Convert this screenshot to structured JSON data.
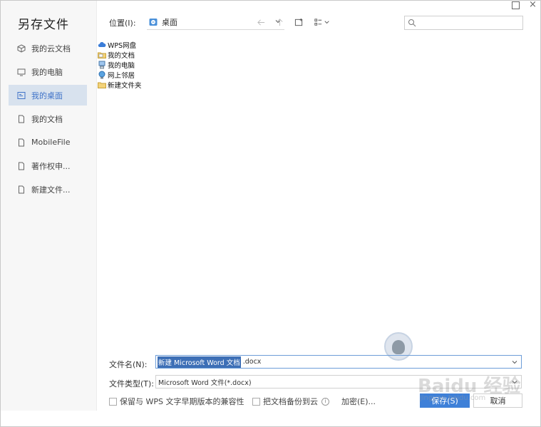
{
  "dialog": {
    "title": "另存文件"
  },
  "sidebar": {
    "items": [
      {
        "label": "我的云文档",
        "icon": "cloud-cube-icon",
        "active": false
      },
      {
        "label": "我的电脑",
        "icon": "monitor-icon",
        "active": false
      },
      {
        "label": "我的桌面",
        "icon": "desktop-icon",
        "active": true
      },
      {
        "label": "我的文档",
        "icon": "document-icon",
        "active": false
      },
      {
        "label": "MobileFile",
        "icon": "document-icon",
        "active": false
      },
      {
        "label": "著作权申...",
        "icon": "document-icon",
        "active": false
      },
      {
        "label": "新建文件...",
        "icon": "document-icon",
        "active": false
      }
    ]
  },
  "toolbar": {
    "location_label": "位置(I):",
    "location_value": "桌面",
    "search_placeholder": ""
  },
  "files": [
    {
      "name": "WPS网盘",
      "icon": "cloud-drive-icon"
    },
    {
      "name": "我的文档",
      "icon": "folder-docs-icon"
    },
    {
      "name": "我的电脑",
      "icon": "computer-icon"
    },
    {
      "name": "网上邻居",
      "icon": "network-icon"
    },
    {
      "name": "新建文件夹",
      "icon": "folder-icon"
    }
  ],
  "bottom": {
    "filename_label": "文件名(N):",
    "filename_selected": "新建 Microsoft Word 文档",
    "filename_ext": ".docx",
    "filetype_label": "文件类型(T):",
    "filetype_value": "Microsoft Word 文件(*.docx)",
    "compat_label": "保留与 WPS 文字早期版本的兼容性",
    "backup_label": "把文档备份到云",
    "info_glyph": "i",
    "encrypt_label": "加密(E)...",
    "save_label": "保存(S)",
    "cancel_label": "取消"
  },
  "watermark": {
    "text": "Baidu 经验",
    "sub": "jingyan.baidu.com"
  },
  "colors": {
    "accent": "#3e80d8",
    "active_bg": "#d8e2ee",
    "selection": "#3d6fb6"
  }
}
